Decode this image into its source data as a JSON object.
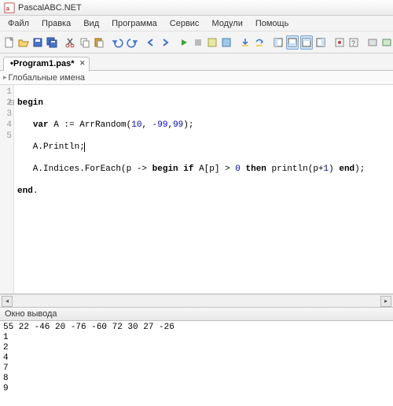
{
  "app": {
    "title": "PascalABC.NET"
  },
  "menu": {
    "items": [
      "Файл",
      "Правка",
      "Вид",
      "Программа",
      "Сервис",
      "Модули",
      "Помощь"
    ]
  },
  "tabs": {
    "active": "•Program1.pas*"
  },
  "scope": {
    "label": "Глобальные имена"
  },
  "gutter": {
    "lines": [
      "1",
      "2",
      "3",
      "4",
      "5"
    ]
  },
  "code": {
    "l1_kw1": "begin",
    "l2_kw1": "var",
    "l2_txt1": " A := ArrRandom(",
    "l2_n1": "10",
    "l2_c1": ", ",
    "l2_n2": "-99",
    "l2_c2": ",",
    "l2_n3": "99",
    "l2_txt2": ");",
    "l3_txt": "   A.Println;",
    "l4_txt1": "   A.Indices.ForEach(p -> ",
    "l4_kw1": "begin",
    "l4_txt2": " ",
    "l4_kw2": "if",
    "l4_txt3": " A[p] > ",
    "l4_n1": "0",
    "l4_txt4": " ",
    "l4_kw3": "then",
    "l4_txt5": " println(p+",
    "l4_n2": "1",
    "l4_txt6": ") ",
    "l4_kw4": "end",
    "l4_txt7": ");",
    "l5_kw1": "end",
    "l5_txt": "."
  },
  "output": {
    "title": "Окно вывода",
    "text": "55 22 -46 20 -76 -60 72 30 27 -26\n1\n2\n4\n7\n8\n9"
  }
}
